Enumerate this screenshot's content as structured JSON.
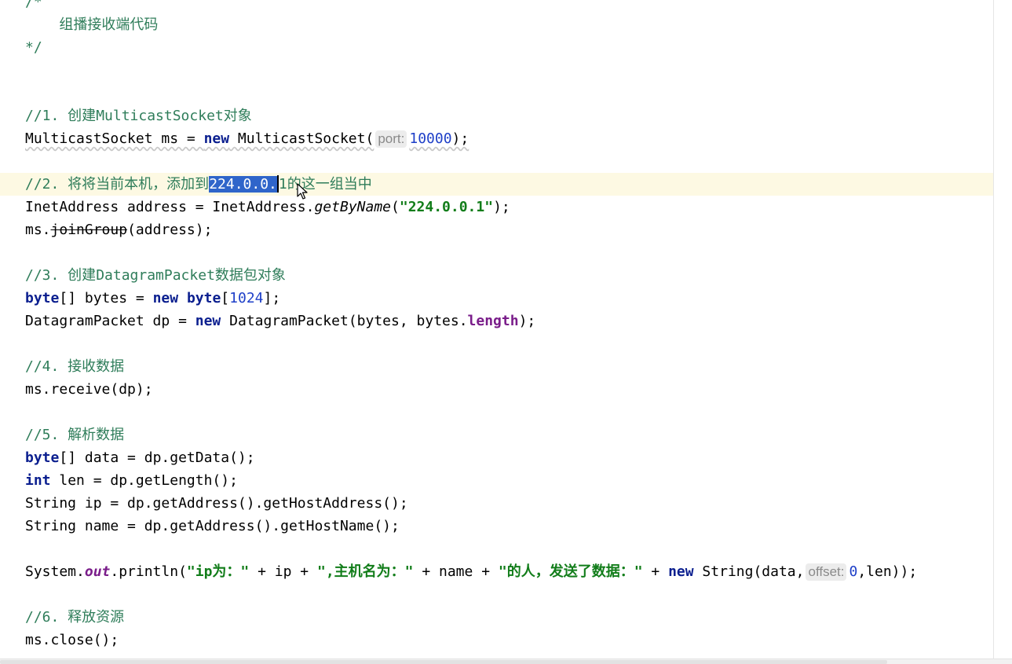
{
  "editor": {
    "comment_block": {
      "open": "/*",
      "text": "    组播接收端代码",
      "close": "*/"
    },
    "step1": {
      "comment_prefix": "//1. 创建",
      "comment_code": "MulticastSocket",
      "comment_suffix": "对象",
      "code_type": "MulticastSocket ms = ",
      "code_new": "new",
      "code_ctor": " MulticastSocket(",
      "hint": "port:",
      "arg": "10000",
      "code_end": ");"
    },
    "step2": {
      "comment_prefix": "//2. 将将当前本机，添加到",
      "comment_selected": "224.0.0.",
      "comment_after_caret": "1",
      "comment_suffix": "的这一组当中",
      "line1_start": "InetAddress address = InetAddress.",
      "line1_method": "getByName",
      "line1_open": "(",
      "line1_string": "\"224.0.0.1\"",
      "line1_end": ");",
      "line2_start": "ms.",
      "line2_method": "joinGroup",
      "line2_end": "(address);"
    },
    "step3": {
      "comment_prefix": "//3. 创建",
      "comment_code": "DatagramPacket",
      "comment_suffix": "数据包对象",
      "line1_kw1": "byte",
      "line1_mid1": "[] bytes = ",
      "line1_kw2": "new",
      "line1_sp": " ",
      "line1_kw3": "byte",
      "line1_open": "[",
      "line1_num": "1024",
      "line1_end": "];",
      "line2_start": "DatagramPacket dp = ",
      "line2_kw": "new",
      "line2_mid": " DatagramPacket(bytes, bytes.",
      "line2_field": "length",
      "line2_end": ");"
    },
    "step4": {
      "comment": "//4. 接收数据",
      "code": "ms.receive(dp);"
    },
    "step5": {
      "comment": "//5. 解析数据",
      "line1_kw": "byte",
      "line1_rest": "[] data = dp.getData();",
      "line2_kw": "int",
      "line2_rest": " len = dp.getLength();",
      "line3": "String ip = dp.getAddress().getHostAddress();",
      "line4": "String name = dp.getAddress().getHostName();",
      "print_start": "System.",
      "print_field": "out",
      "print_call": ".println(",
      "print_str1": "\"ip为：\"",
      "print_mid1": " + ip + ",
      "print_str2": "\",主机名为：\"",
      "print_mid2": " + name + ",
      "print_str3": "\"的人，发送了数据：\"",
      "print_mid3": " + ",
      "print_new": "new",
      "print_mid4": " String(data,",
      "print_hint": "offset:",
      "print_num": "0",
      "print_end": ",len));"
    },
    "step6": {
      "comment": "//6. 释放资源",
      "code": "ms.close();"
    }
  },
  "colors": {
    "keyword": "#0b1f8f",
    "comment": "#2f7d5a",
    "string": "#127d1a",
    "number": "#1f40c8",
    "field": "#7a1d8a",
    "current_line": "#fdf9e3",
    "selection": "#2f65ca"
  },
  "icons": {
    "mouse_cursor": "arrow-cursor-icon"
  }
}
